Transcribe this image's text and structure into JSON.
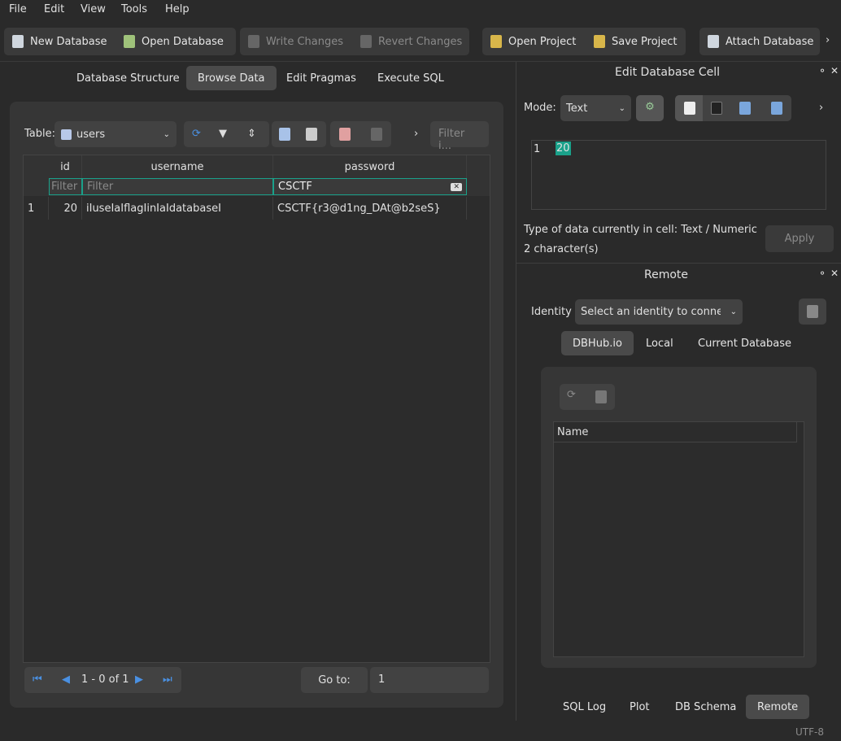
{
  "menu": [
    "File",
    "Edit",
    "View",
    "Tools",
    "Help"
  ],
  "toolbar": {
    "new_db": "New Database",
    "open_db": "Open Database",
    "write": "Write Changes",
    "revert": "Revert Changes",
    "open_project": "Open Project",
    "save_project": "Save Project",
    "attach": "Attach Database",
    "more": "›"
  },
  "tabs": [
    "Database Structure",
    "Browse Data",
    "Edit Pragmas",
    "Execute SQL"
  ],
  "browse": {
    "table_label": "Table:",
    "table_value": "users",
    "filter_placeholder": "Filter i...",
    "more": "›",
    "columns": [
      "id",
      "username",
      "password"
    ],
    "filters": [
      "Filter",
      "Filter",
      "CSCTF"
    ],
    "rows": [
      {
        "rownum": "1",
        "id": "20",
        "username": "iIuseIaIflagIinIaIdatabaseI",
        "password": "CSCTF{r3@d1ng_DAt@b2seS}"
      }
    ],
    "pager": "1 - 0 of 1",
    "goto_label": "Go to:",
    "goto_value": "1"
  },
  "edit_cell": {
    "title": "Edit Database Cell",
    "mode_label": "Mode:",
    "mode_value": "Text",
    "line_no": "1",
    "content": "20",
    "type_info": "Type of data currently in cell: Text / Numeric",
    "chars": "2 character(s)",
    "apply": "Apply",
    "more": "›"
  },
  "remote": {
    "title": "Remote",
    "identity_label": "Identity",
    "identity_value": "Select an identity to connect",
    "tabs": [
      "DBHub.io",
      "Local",
      "Current Database"
    ],
    "column": "Name"
  },
  "bottom_tabs": [
    "SQL Log",
    "Plot",
    "DB Schema",
    "Remote"
  ],
  "status": {
    "encoding": "UTF-8"
  },
  "colors": {
    "accent": "#1aa18a",
    "bg": "#2a2a2a",
    "panel": "#3a3a3a"
  }
}
